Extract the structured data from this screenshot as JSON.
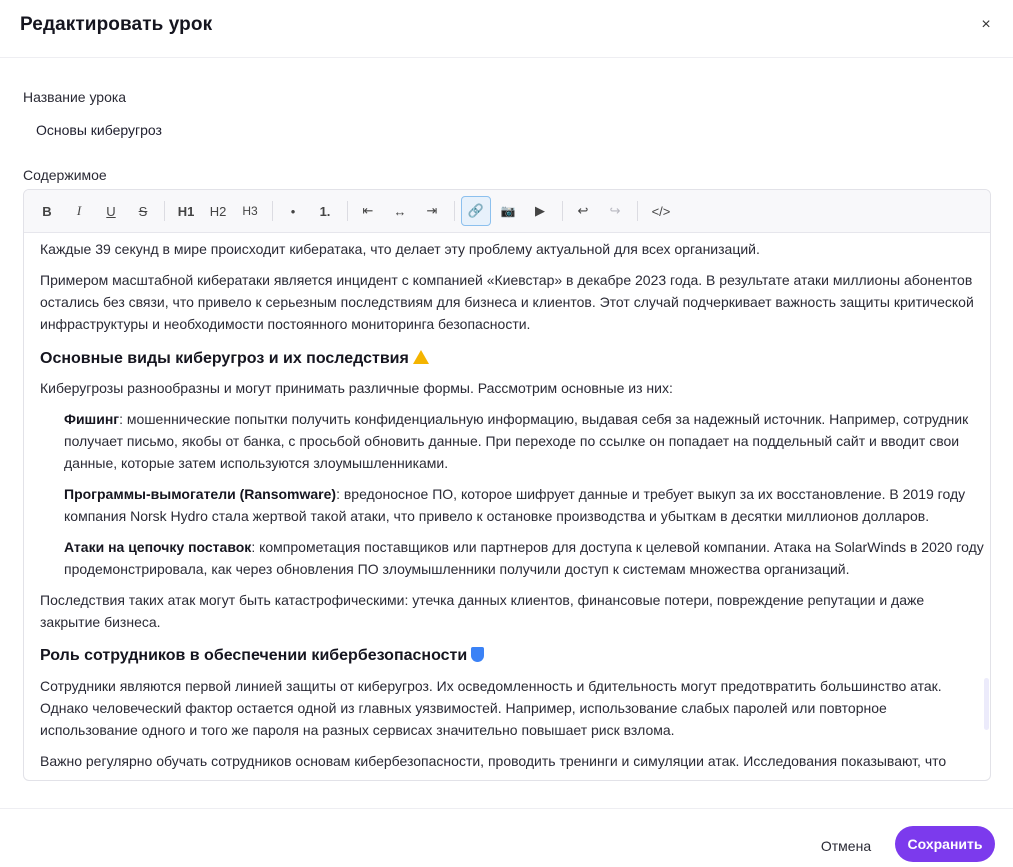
{
  "dialog": {
    "title": "Редактировать урок",
    "close_glyph": "×"
  },
  "form": {
    "name_label": "Название урока",
    "name_value": "Основы киберугроз",
    "content_label": "Содержимое"
  },
  "toolbar": {
    "bold": "B",
    "italic": "I",
    "underline": "U",
    "strike": "S",
    "h1": "H1",
    "h2": "H2",
    "h3": "H3",
    "bullet": "•",
    "ordered": "1.",
    "align_left": "⇤",
    "align_center": "↔",
    "align_right": "⇥",
    "link": "🔗",
    "image": "📷",
    "video": "▶",
    "undo": "↩",
    "redo": "↪",
    "code": "</>"
  },
  "content": {
    "p1": "Каждые 39 секунд в мире происходит кибератака, что делает эту проблему актуальной для всех организаций.",
    "p2_l1": "Примером масштабной кибератаки является инцидент с компанией «Киевстар» в декабре 2023 года. В результате атаки миллионы абонентов",
    "p2_l2": "остались без связи, что привело к серьезным последствиям для бизнеса и клиентов. Этот случай подчеркивает важность защиты критической",
    "p2_l3": "инфраструктуры и необходимости постоянного мониторинга безопасности.",
    "h1": "Основные виды киберугроз и их последствия",
    "p3": "Киберугрозы разнообразны и могут принимать различные формы. Рассмотрим основные из них:",
    "li1_bold": "Фишинг",
    "li1_l1": ": мошеннические попытки получить конфиденциальную информацию, выдавая себя за надежный источник. Например, сотрудник",
    "li1_l2": "получает письмо, якобы от банка, с просьбой обновить данные. При переходе по ссылке он попадает на поддельный сайт и вводит свои",
    "li1_l3": "данные, которые затем используются злоумышленниками.",
    "li2_bold": "Программы-вымогатели (Ransomware)",
    "li2_l1": ": вредоносное ПО, которое шифрует данные и требует выкуп за их восстановление. В 2019 году",
    "li2_l2": "компания Norsk Hydro стала жертвой такой атаки, что привело к остановке производства и убыткам в десятки миллионов долларов.",
    "li3_bold": "Атаки на цепочку поставок",
    "li3_l1": ": компрометация поставщиков или партнеров для доступа к целевой компании. Атака на SolarWinds в 2020 году",
    "li3_l2": "продемонстрировала, как через обновления ПО злоумышленники получили доступ к системам множества организаций.",
    "p4_l1": "Последствия таких атак могут быть катастрофическими: утечка данных клиентов, финансовые потери, повреждение репутации и даже",
    "p4_l2": "закрытие бизнеса.",
    "h2": "Роль сотрудников в обеспечении кибербезопасности",
    "p5_l1": "Сотрудники являются первой линией защиты от киберугроз. Их осведомленность и бдительность могут предотвратить большинство атак.",
    "p5_l2": "Однако человеческий фактор остается одной из главных уязвимостей. Например, использование слабых паролей или повторное",
    "p5_l3": "использование одного и того же пароля на разных сервисах значительно повышает риск взлома.",
    "p6_l1": "Важно регулярно обучать сотрудников основам кибербезопасности, проводить тренинги и симуляции атак. Исследования показывают, что"
  },
  "footer": {
    "cancel": "Отмена",
    "save": "Сохранить"
  },
  "colors": {
    "accent": "#7c3aed",
    "link_active_border": "#8cc0ee"
  },
  "icons": {
    "close": "close-icon",
    "warning": "warning-icon",
    "shield": "shield-icon"
  }
}
